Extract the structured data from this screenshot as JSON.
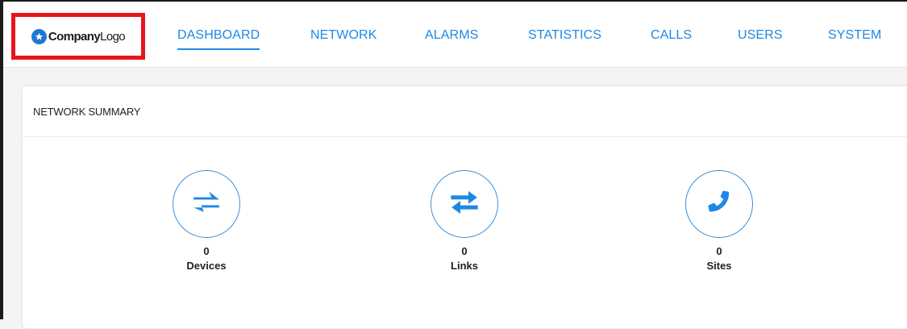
{
  "logo": {
    "bold_text": "Company",
    "light_text": "Logo"
  },
  "nav": {
    "items": [
      {
        "label": "DASHBOARD",
        "active": true
      },
      {
        "label": "NETWORK"
      },
      {
        "label": "ALARMS"
      },
      {
        "label": "STATISTICS"
      },
      {
        "label": "CALLS"
      },
      {
        "label": "USERS"
      },
      {
        "label": "SYSTEM"
      }
    ]
  },
  "summary": {
    "title": "NETWORK SUMMARY",
    "stats": [
      {
        "value": "0",
        "label": "Devices",
        "icon": "swap-horizontal-icon"
      },
      {
        "value": "0",
        "label": "Links",
        "icon": "arrows-exchange-icon"
      },
      {
        "value": "0",
        "label": "Sites",
        "icon": "phone-icon"
      }
    ]
  },
  "colors": {
    "accent": "#1e88e5",
    "logo_highlight": "#e8151c"
  }
}
